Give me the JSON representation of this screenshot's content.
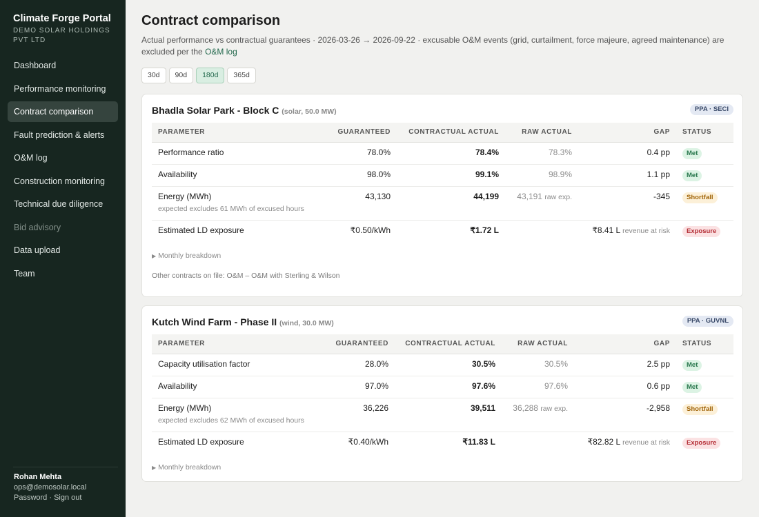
{
  "sidebar": {
    "brand": "Climate Forge Portal",
    "org": "DEMO SOLAR HOLDINGS PVT LTD",
    "nav": [
      {
        "label": "Dashboard"
      },
      {
        "label": "Performance monitoring"
      },
      {
        "label": "Contract comparison"
      },
      {
        "label": "Fault prediction & alerts"
      },
      {
        "label": "O&M log"
      },
      {
        "label": "Construction monitoring"
      },
      {
        "label": "Technical due diligence"
      },
      {
        "label": "Bid advisory"
      },
      {
        "label": "Data upload"
      },
      {
        "label": "Team"
      }
    ],
    "user": {
      "name": "Rohan Mehta",
      "email": "ops@demosolar.local",
      "password_link": "Password",
      "separator": "·",
      "signout_link": "Sign out"
    }
  },
  "page": {
    "title": "Contract comparison",
    "subtitle_prefix": "Actual performance vs contractual guarantees · 2026-03-26 → 2026-09-22 · excusable O&M events (grid, curtailment, force majeure, agreed maintenance) are excluded per the",
    "subtitle_link": "O&M log",
    "ranges": [
      "30d",
      "90d",
      "180d",
      "365d"
    ],
    "active_range": "180d"
  },
  "table_headers": {
    "parameter": "PARAMETER",
    "guaranteed": "GUARANTEED",
    "contractual_actual": "CONTRACTUAL ACTUAL",
    "raw_actual": "RAW ACTUAL",
    "gap": "GAP",
    "status": "STATUS"
  },
  "contracts": [
    {
      "name": "Bhadla Solar Park - Block C",
      "meta": "(solar, 50.0 MW)",
      "tag": "PPA · SECI",
      "rows": [
        {
          "parameter": "Performance ratio",
          "guaranteed": "78.0%",
          "contractual": "78.4%",
          "raw": "78.3%",
          "gap": "0.4 pp",
          "status": "Met"
        },
        {
          "parameter": "Availability",
          "guaranteed": "98.0%",
          "contractual": "99.1%",
          "raw": "98.9%",
          "gap": "1.1 pp",
          "status": "Met"
        },
        {
          "parameter": "Energy (MWh)",
          "note": "expected excludes 61 MWh of excused hours",
          "guaranteed": "43,130",
          "contractual": "44,199",
          "raw": "43,191",
          "raw_hint": "raw exp.",
          "gap": "-345",
          "status": "Shortfall"
        },
        {
          "parameter": "Estimated LD exposure",
          "guaranteed": "₹0.50/kWh",
          "contractual": "₹1.72 L",
          "raw": "",
          "gap": "₹8.41 L",
          "gap_hint": "revenue at risk",
          "status": "Exposure"
        }
      ],
      "breakdown_label": "Monthly breakdown",
      "other_contracts": "Other contracts on file: O&M – O&M with Sterling & Wilson"
    },
    {
      "name": "Kutch Wind Farm - Phase II",
      "meta": "(wind, 30.0 MW)",
      "tag": "PPA · GUVNL",
      "rows": [
        {
          "parameter": "Capacity utilisation factor",
          "guaranteed": "28.0%",
          "contractual": "30.5%",
          "raw": "30.5%",
          "gap": "2.5 pp",
          "status": "Met"
        },
        {
          "parameter": "Availability",
          "guaranteed": "97.0%",
          "contractual": "97.6%",
          "raw": "97.6%",
          "gap": "0.6 pp",
          "status": "Met"
        },
        {
          "parameter": "Energy (MWh)",
          "note": "expected excludes 62 MWh of excused hours",
          "guaranteed": "36,226",
          "contractual": "39,511",
          "raw": "36,288",
          "raw_hint": "raw exp.",
          "gap": "-2,958",
          "status": "Shortfall"
        },
        {
          "parameter": "Estimated LD exposure",
          "guaranteed": "₹0.40/kWh",
          "contractual": "₹11.83 L",
          "raw": "",
          "gap": "₹82.82 L",
          "gap_hint": "revenue at risk",
          "status": "Exposure"
        }
      ],
      "breakdown_label": "Monthly breakdown"
    }
  ],
  "colors": {
    "sidebar_bg": "#172620",
    "accent": "#22684c",
    "met": "#247449",
    "shortfall": "#a1650a",
    "exposure": "#b42d35"
  }
}
